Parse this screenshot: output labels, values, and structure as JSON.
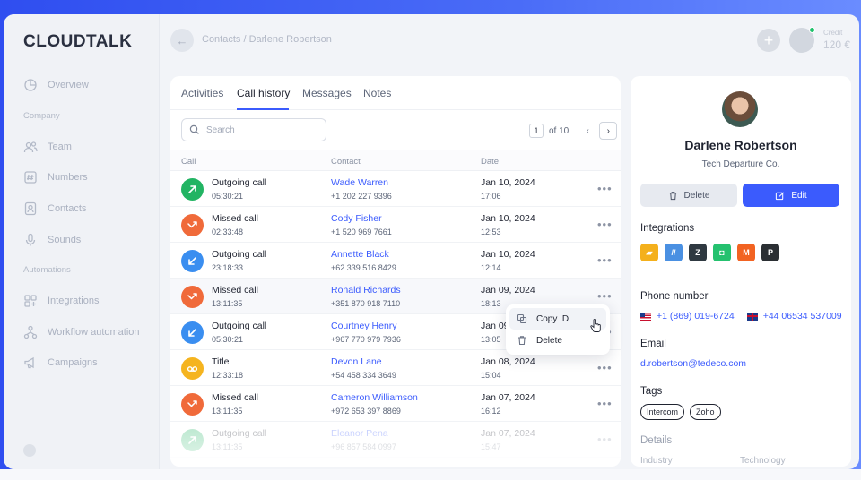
{
  "app": {
    "logo": "CLOUDTALK"
  },
  "sidebar": {
    "items": [
      {
        "label": "Overview",
        "icon": "pie-chart-icon"
      },
      {
        "section": "Company"
      },
      {
        "label": "Team",
        "icon": "users-icon"
      },
      {
        "label": "Numbers",
        "icon": "hash-icon"
      },
      {
        "label": "Contacts",
        "icon": "contacts-icon"
      },
      {
        "label": "Sounds",
        "icon": "microphone-icon"
      },
      {
        "section": "Automations"
      },
      {
        "label": "Integrations",
        "icon": "grid-icon"
      },
      {
        "label": "Workflow automation",
        "icon": "workflow-icon"
      },
      {
        "label": "Campaigns",
        "icon": "megaphone-icon"
      }
    ]
  },
  "topbar": {
    "breadcrumb": "Contacts / Darlene Robertson",
    "credit_label": "Credit",
    "credit_value": "120 €"
  },
  "tabs": [
    {
      "label": "Activities"
    },
    {
      "label": "Call history",
      "active": true
    },
    {
      "label": "Messages"
    },
    {
      "label": "Notes"
    }
  ],
  "search": {
    "placeholder": "Search"
  },
  "pager": {
    "page": "1",
    "of": "of 10"
  },
  "table": {
    "headers": {
      "call": "Call",
      "contact": "Contact",
      "date": "Date"
    },
    "rows": [
      {
        "type": "Outgoing call",
        "duration": "05:30:21",
        "name": "Wade Warren",
        "phone": "+1 202 227 9396",
        "date": "Jan 10, 2024",
        "time": "17:06",
        "kind": "outgoing",
        "color": "#22b463"
      },
      {
        "type": "Missed call",
        "duration": "02:33:48",
        "name": "Cody Fisher",
        "phone": "+1 520 969 7661",
        "date": "Jan 10, 2024",
        "time": "12:53",
        "kind": "missed",
        "color": "#f06a3a"
      },
      {
        "type": "Outgoing call",
        "duration": "23:18:33",
        "name": "Annette Black",
        "phone": "+62 339 516 8429",
        "date": "Jan 10, 2024",
        "time": "12:14",
        "kind": "incoming",
        "color": "#3a8ef0"
      },
      {
        "type": "Missed call",
        "duration": "13:11:35",
        "name": "Ronald Richards",
        "phone": "+351 870 918 7110",
        "date": "Jan 09, 2024",
        "time": "18:13",
        "kind": "missed",
        "color": "#f06a3a"
      },
      {
        "type": "Outgoing call",
        "duration": "05:30:21",
        "name": "Courtney Henry",
        "phone": "+967 770 979 7936",
        "date": "Jan 09",
        "time": "13:05",
        "kind": "incoming",
        "color": "#3a8ef0"
      },
      {
        "type": "Title",
        "duration": "12:33:18",
        "name": "Devon Lane",
        "phone": "+54 458 334 3649",
        "date": "Jan 08, 2024",
        "time": "15:04",
        "kind": "voicemail",
        "color": "#f5b41f"
      },
      {
        "type": "Missed call",
        "duration": "13:11:35",
        "name": "Cameron Williamson",
        "phone": "+972 653 397 8869",
        "date": "Jan 07, 2024",
        "time": "16:12",
        "kind": "missed",
        "color": "#f06a3a"
      },
      {
        "type": "Outgoing call",
        "duration": "13:11:35",
        "name": "Eleanor Pena",
        "phone": "+96 857 584 0997",
        "date": "Jan 07, 2024",
        "time": "15:47",
        "kind": "outgoing",
        "color": "#22b463"
      }
    ]
  },
  "context_menu": {
    "copy_id": "Copy ID",
    "delete": "Delete"
  },
  "profile": {
    "name": "Darlene Robertson",
    "company": "Tech Departure Co.",
    "delete_label": "Delete",
    "edit_label": "Edit",
    "integrations_title": "Integrations",
    "integrations": [
      {
        "icon": "integration-yellow-icon",
        "color": "#f4b01c"
      },
      {
        "icon": "integration-blue-icon",
        "color": "#4a90e2"
      },
      {
        "icon": "zendesk-icon",
        "color": "#2f3941"
      },
      {
        "icon": "freshdesk-icon",
        "color": "#25c16f"
      },
      {
        "icon": "magento-icon",
        "color": "#f26322"
      },
      {
        "icon": "pipedrive-icon",
        "color": "#2b2f33"
      }
    ],
    "phone_title": "Phone number",
    "phones": [
      {
        "flag": "us-flag-icon",
        "number": "+1 (869) 019-6724"
      },
      {
        "flag": "uk-flag-icon",
        "number": "+44 06534 537009"
      }
    ],
    "email_title": "Email",
    "email": "d.robertson@tedeco.com",
    "tags_title": "Tags",
    "tags": [
      "Intercom",
      "Zoho"
    ],
    "details_title": "Details",
    "details_label": "Industry",
    "details_value": "Technology"
  },
  "colors": {
    "accent": "#3b5bfd"
  }
}
